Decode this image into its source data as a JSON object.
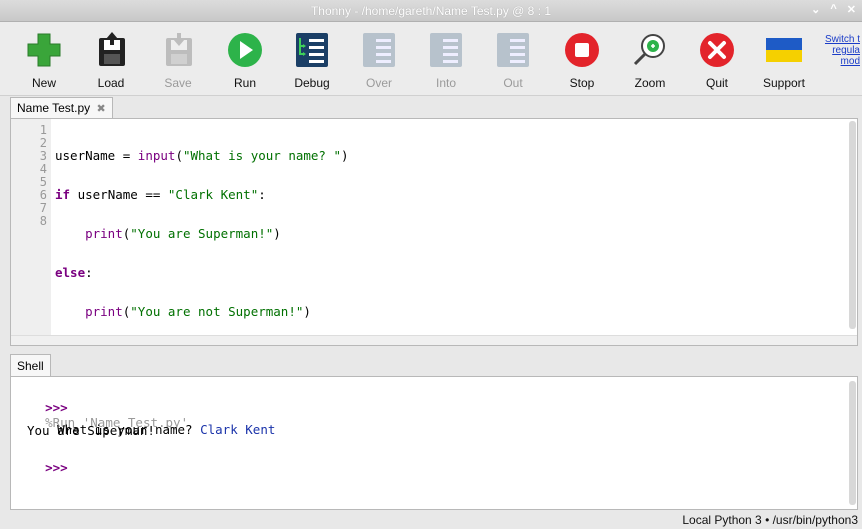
{
  "window": {
    "title": "Thonny  -  /home/gareth/Name Test.py  @  8 : 1"
  },
  "window_controls": {
    "minimize": "⌄",
    "maximize": "^",
    "close": "✕"
  },
  "toolbar": {
    "buttons": [
      {
        "label": "New",
        "icon": "new-icon",
        "enabled": true
      },
      {
        "label": "Load",
        "icon": "load-icon",
        "enabled": true
      },
      {
        "label": "Save",
        "icon": "save-icon",
        "enabled": false
      },
      {
        "label": "Run",
        "icon": "run-icon",
        "enabled": true
      },
      {
        "label": "Debug",
        "icon": "debug-icon",
        "enabled": true
      },
      {
        "label": "Over",
        "icon": "step-over-icon",
        "enabled": false
      },
      {
        "label": "Into",
        "icon": "step-into-icon",
        "enabled": false
      },
      {
        "label": "Out",
        "icon": "step-out-icon",
        "enabled": false
      },
      {
        "label": "Stop",
        "icon": "stop-icon",
        "enabled": true
      },
      {
        "label": "Zoom",
        "icon": "zoom-icon",
        "enabled": true
      },
      {
        "label": "Quit",
        "icon": "quit-icon",
        "enabled": true
      },
      {
        "label": "Support",
        "icon": "support-flag-icon",
        "enabled": true
      }
    ],
    "promo_lines": [
      "Switch t",
      "regula",
      "mod"
    ]
  },
  "editor": {
    "tab_label": "Name Test.py",
    "tab_close": "✖",
    "line_numbers": [
      "1",
      "2",
      "3",
      "4",
      "5",
      "6",
      "7",
      "8"
    ],
    "code_lines": [
      "userName = input(\"What is your name? \")",
      "if userName == \"Clark Kent\":",
      "    print(\"You are Superman!\")",
      "else:",
      "    print(\"You are not Superman!\")"
    ]
  },
  "shell": {
    "tab_label": "Shell",
    "prompt": ">>>",
    "run_command": "%Run 'Name Test.py'",
    "question": "What is your name? ",
    "user_input": "Clark Kent",
    "output": "You are Superman!"
  },
  "status": {
    "text": "Local Python 3  •  /usr/bin/python3"
  },
  "colors": {
    "keyword": "#7a0080",
    "string": "#007000",
    "user_input": "#1a33aa",
    "run_green": "#2db34a",
    "stop_red": "#e3242b",
    "debug_blue": "#1b3f66"
  }
}
